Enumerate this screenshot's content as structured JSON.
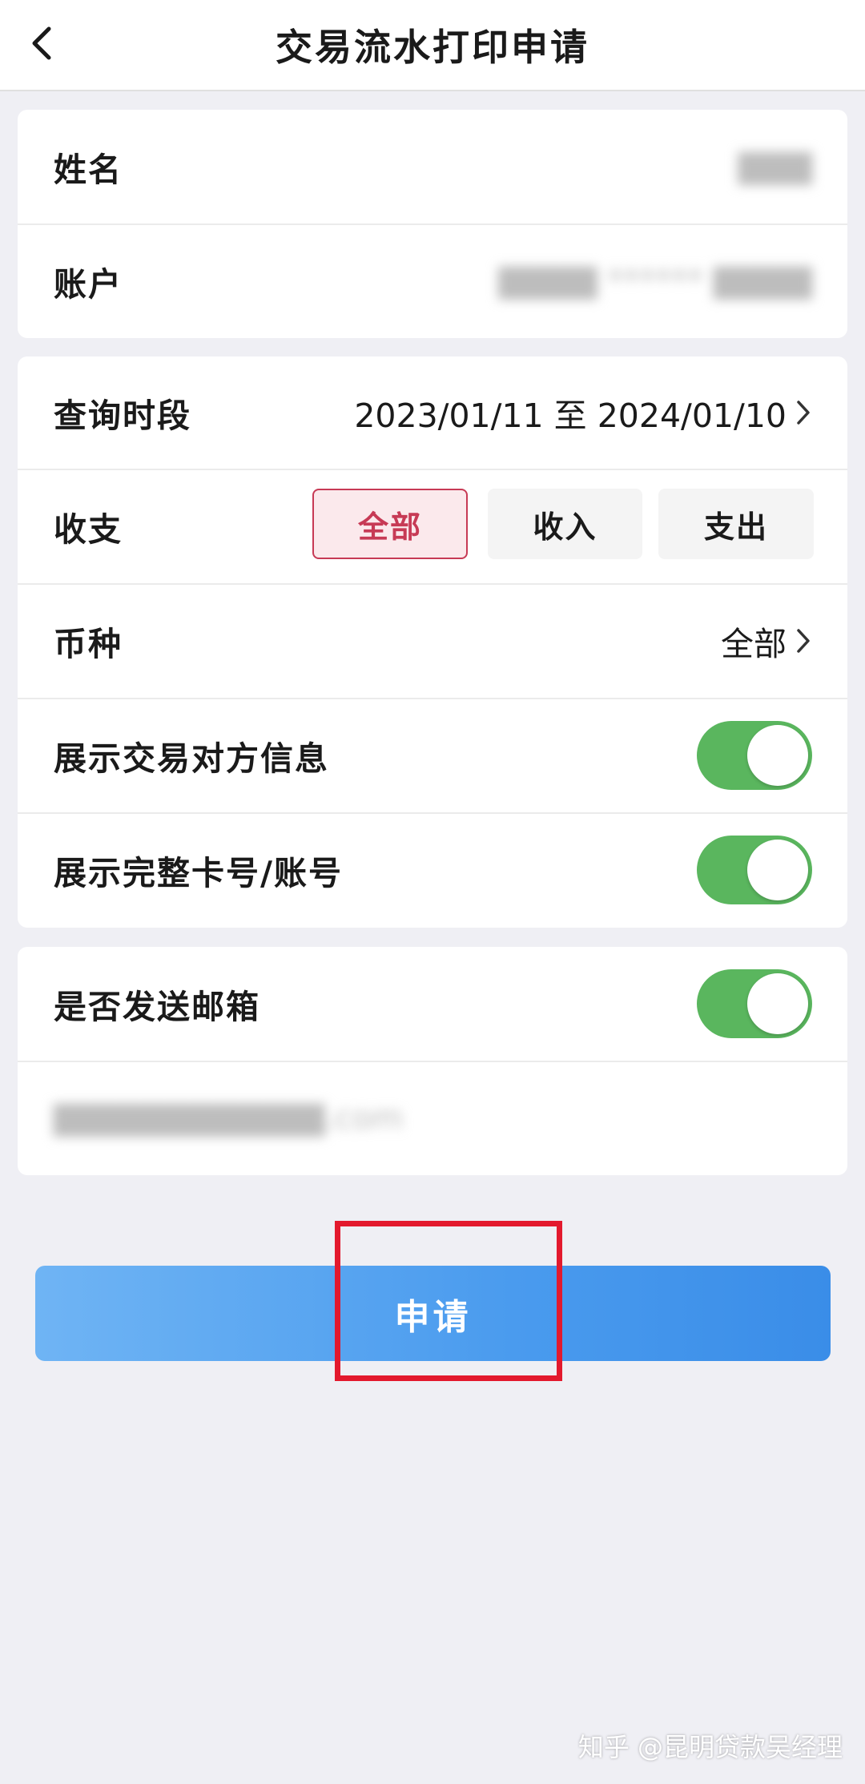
{
  "header": {
    "title": "交易流水打印申请",
    "back_icon": "chevron-left-icon"
  },
  "account_card": {
    "name_label": "姓名",
    "name_value": "▇▇▇",
    "account_label": "账户",
    "account_value": "▇▇▇▇ ****** ▇▇▇▇"
  },
  "filter_card": {
    "period_label": "查询时段",
    "period_value": "2023/01/11 至 2024/01/10",
    "type_label": "收支",
    "type_options": [
      "全部",
      "收入",
      "支出"
    ],
    "type_selected": "全部",
    "currency_label": "币种",
    "currency_value": "全部",
    "show_counterparty_label": "展示交易对方信息",
    "show_counterparty_on": true,
    "show_full_card_label": "展示完整卡号/账号",
    "show_full_card_on": true
  },
  "email_card": {
    "send_email_label": "是否发送邮箱",
    "send_email_on": true,
    "email_value": "▇▇▇▇▇▇▇▇▇▇▇.com"
  },
  "apply_button": {
    "label": "申请"
  },
  "watermark": {
    "text": "知乎 @昆明贷款吴经理"
  },
  "colors": {
    "accent_red": "#c73a55",
    "toggle_green": "#5ab65e",
    "button_blue": "#4a9bee",
    "highlight_red": "#e3192d",
    "page_bg": "#efeff4"
  }
}
